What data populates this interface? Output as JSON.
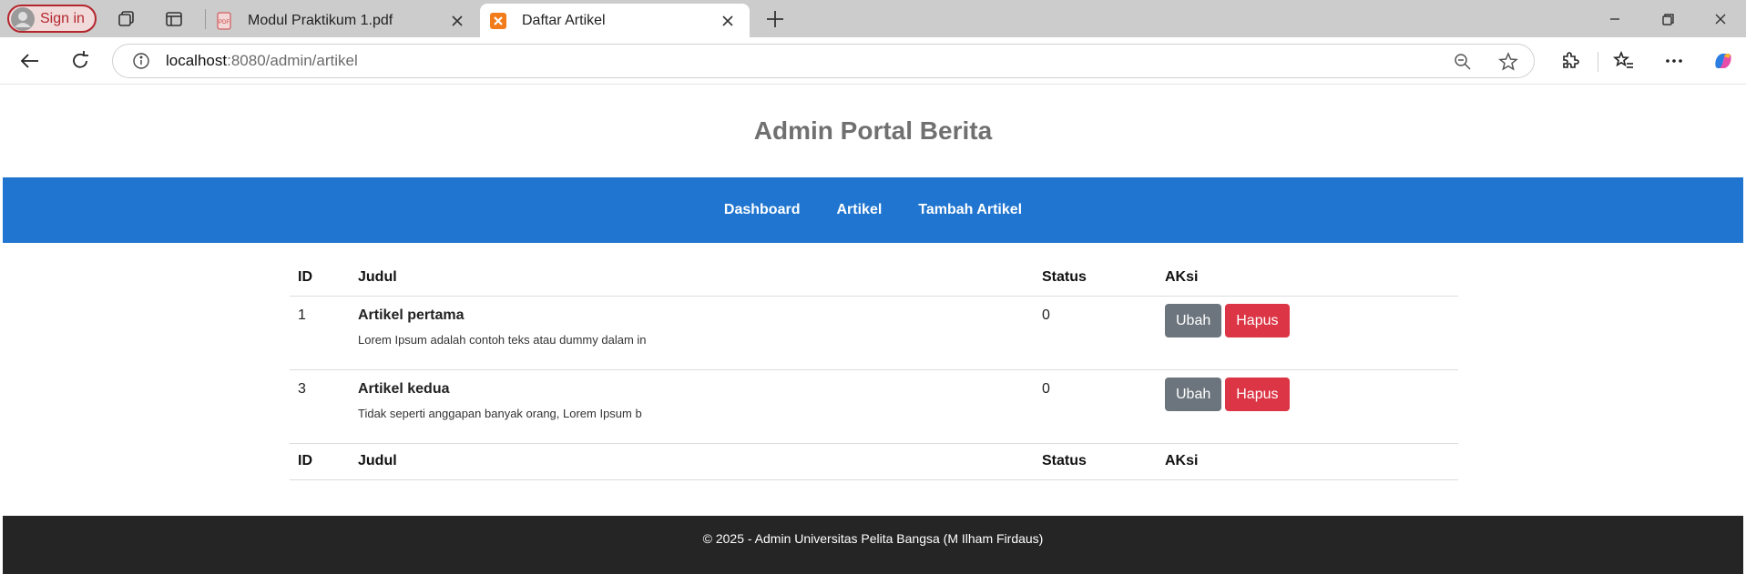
{
  "browser": {
    "signin_label": "Sign in",
    "tabs": [
      {
        "title": "Modul Praktikum 1.pdf",
        "icon": "pdf-file-icon",
        "active": false
      },
      {
        "title": "Daftar Artikel",
        "icon": "xampp-icon",
        "active": true
      }
    ],
    "url_host": "localhost",
    "url_path": ":8080/admin/artikel"
  },
  "site": {
    "title": "Admin Portal Berita",
    "nav": [
      "Dashboard",
      "Artikel",
      "Tambah Artikel"
    ],
    "accent_color": "#1f75cf"
  },
  "table": {
    "headers": [
      "ID",
      "Judul",
      "Status",
      "AKsi"
    ],
    "rows": [
      {
        "id": "1",
        "title": "Artikel pertama",
        "excerpt": "Lorem Ipsum adalah contoh teks atau dummy dalam in",
        "status": "0",
        "edit": "Ubah",
        "delete": "Hapus"
      },
      {
        "id": "3",
        "title": "Artikel kedua",
        "excerpt": "Tidak seperti anggapan banyak orang, Lorem Ipsum b",
        "status": "0",
        "edit": "Ubah",
        "delete": "Hapus"
      }
    ]
  },
  "footer": {
    "text": "© 2025 - Admin Universitas Pelita Bangsa (M Ilham Firdaus)"
  }
}
